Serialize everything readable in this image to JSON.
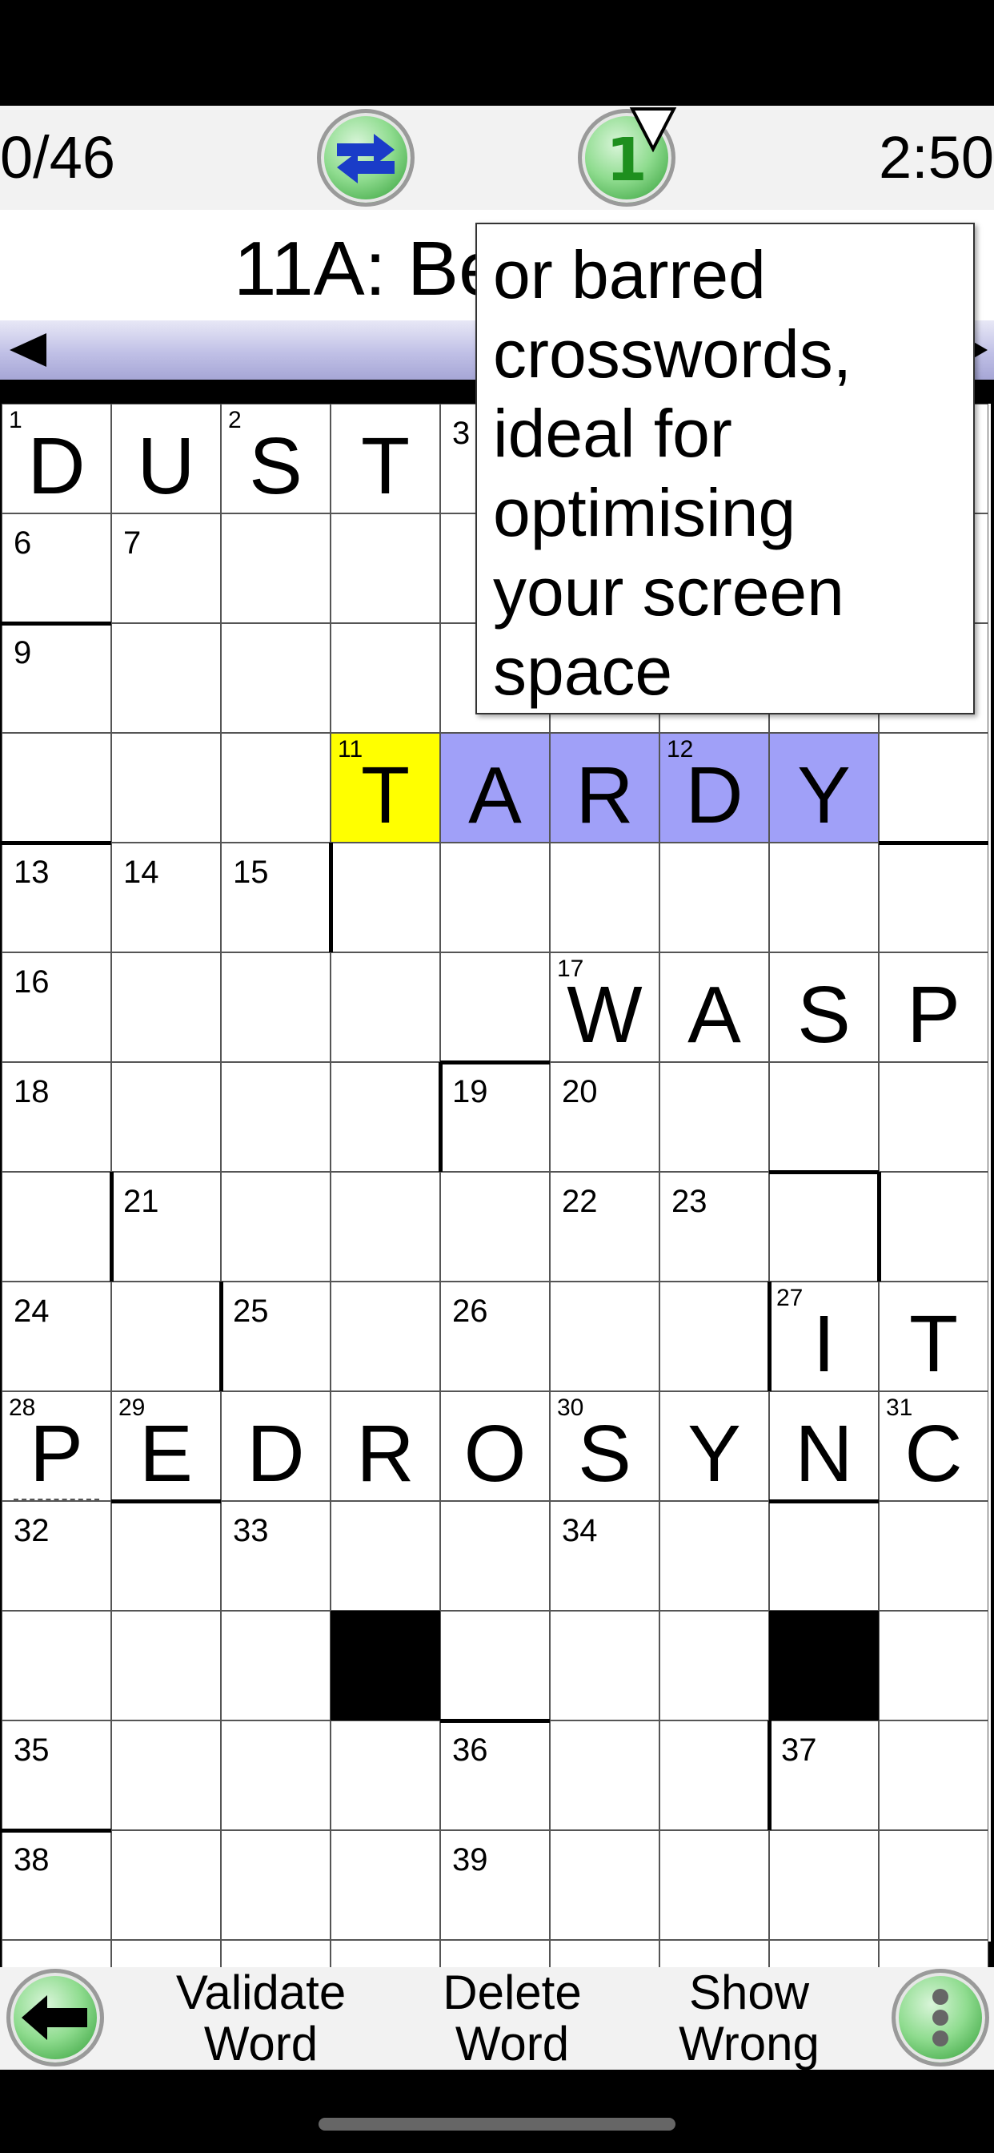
{
  "toolbar": {
    "score": "0/46",
    "timer": "2:50",
    "swap_icon": "swap-arrows-icon",
    "round_label": "1"
  },
  "clue": {
    "text": "11A: Be"
  },
  "tooltip": {
    "lines": [
      "or barred",
      "crosswords,",
      "ideal for",
      "optimising",
      "your screen",
      "space"
    ]
  },
  "grid": {
    "size": 15,
    "cells": {
      "0,0": {
        "n": "1",
        "l": "D"
      },
      "0,1": {
        "l": "U"
      },
      "0,2": {
        "n": "2",
        "l": "S"
      },
      "0,3": {
        "l": "T"
      },
      "0,4": {
        "n": "3"
      },
      "1,0": {
        "n": "6"
      },
      "1,1": {
        "n": "7"
      },
      "2,0": {
        "n": "9"
      },
      "3,3": {
        "n": "11",
        "l": "T",
        "s": "cur"
      },
      "3,4": {
        "l": "A",
        "s": "hl"
      },
      "3,5": {
        "l": "R",
        "s": "hl"
      },
      "3,6": {
        "n": "12",
        "l": "D",
        "s": "hl"
      },
      "3,7": {
        "l": "Y",
        "s": "hl"
      },
      "4,0": {
        "n": "13"
      },
      "4,1": {
        "n": "14"
      },
      "4,2": {
        "n": "15"
      },
      "5,0": {
        "n": "16"
      },
      "5,5": {
        "n": "17",
        "l": "W"
      },
      "5,6": {
        "l": "A"
      },
      "5,7": {
        "l": "S"
      },
      "5,8": {
        "l": "P"
      },
      "6,0": {
        "n": "18"
      },
      "6,4": {
        "n": "19"
      },
      "6,5": {
        "n": "20"
      },
      "7,1": {
        "n": "21"
      },
      "7,5": {
        "n": "22"
      },
      "7,6": {
        "n": "23"
      },
      "8,0": {
        "n": "24"
      },
      "8,2": {
        "n": "25"
      },
      "8,4": {
        "n": "26"
      },
      "8,7": {
        "n": "27",
        "l": "I"
      },
      "8,8": {
        "l": "T"
      },
      "9,0": {
        "n": "28",
        "l": "P"
      },
      "9,1": {
        "n": "29",
        "l": "E"
      },
      "9,2": {
        "l": "D"
      },
      "9,3": {
        "l": "R"
      },
      "9,4": {
        "l": "O"
      },
      "9,5": {
        "n": "30",
        "l": "S"
      },
      "9,6": {
        "l": "Y"
      },
      "9,7": {
        "l": "N"
      },
      "9,8": {
        "n": "31",
        "l": "C"
      },
      "10,0": {
        "n": "32"
      },
      "10,2": {
        "n": "33"
      },
      "10,5": {
        "n": "34"
      },
      "11,3": {
        "s": "block"
      },
      "11,7": {
        "s": "block"
      },
      "12,0": {
        "n": "35"
      },
      "12,4": {
        "n": "36"
      },
      "12,7": {
        "n": "37"
      },
      "13,0": {
        "n": "38"
      },
      "13,4": {
        "n": "39"
      }
    }
  },
  "bottom": {
    "validate": [
      "Validate",
      "Word"
    ],
    "delete": [
      "Delete",
      "Word"
    ],
    "wrong": [
      "Show",
      "Wrong"
    ]
  }
}
